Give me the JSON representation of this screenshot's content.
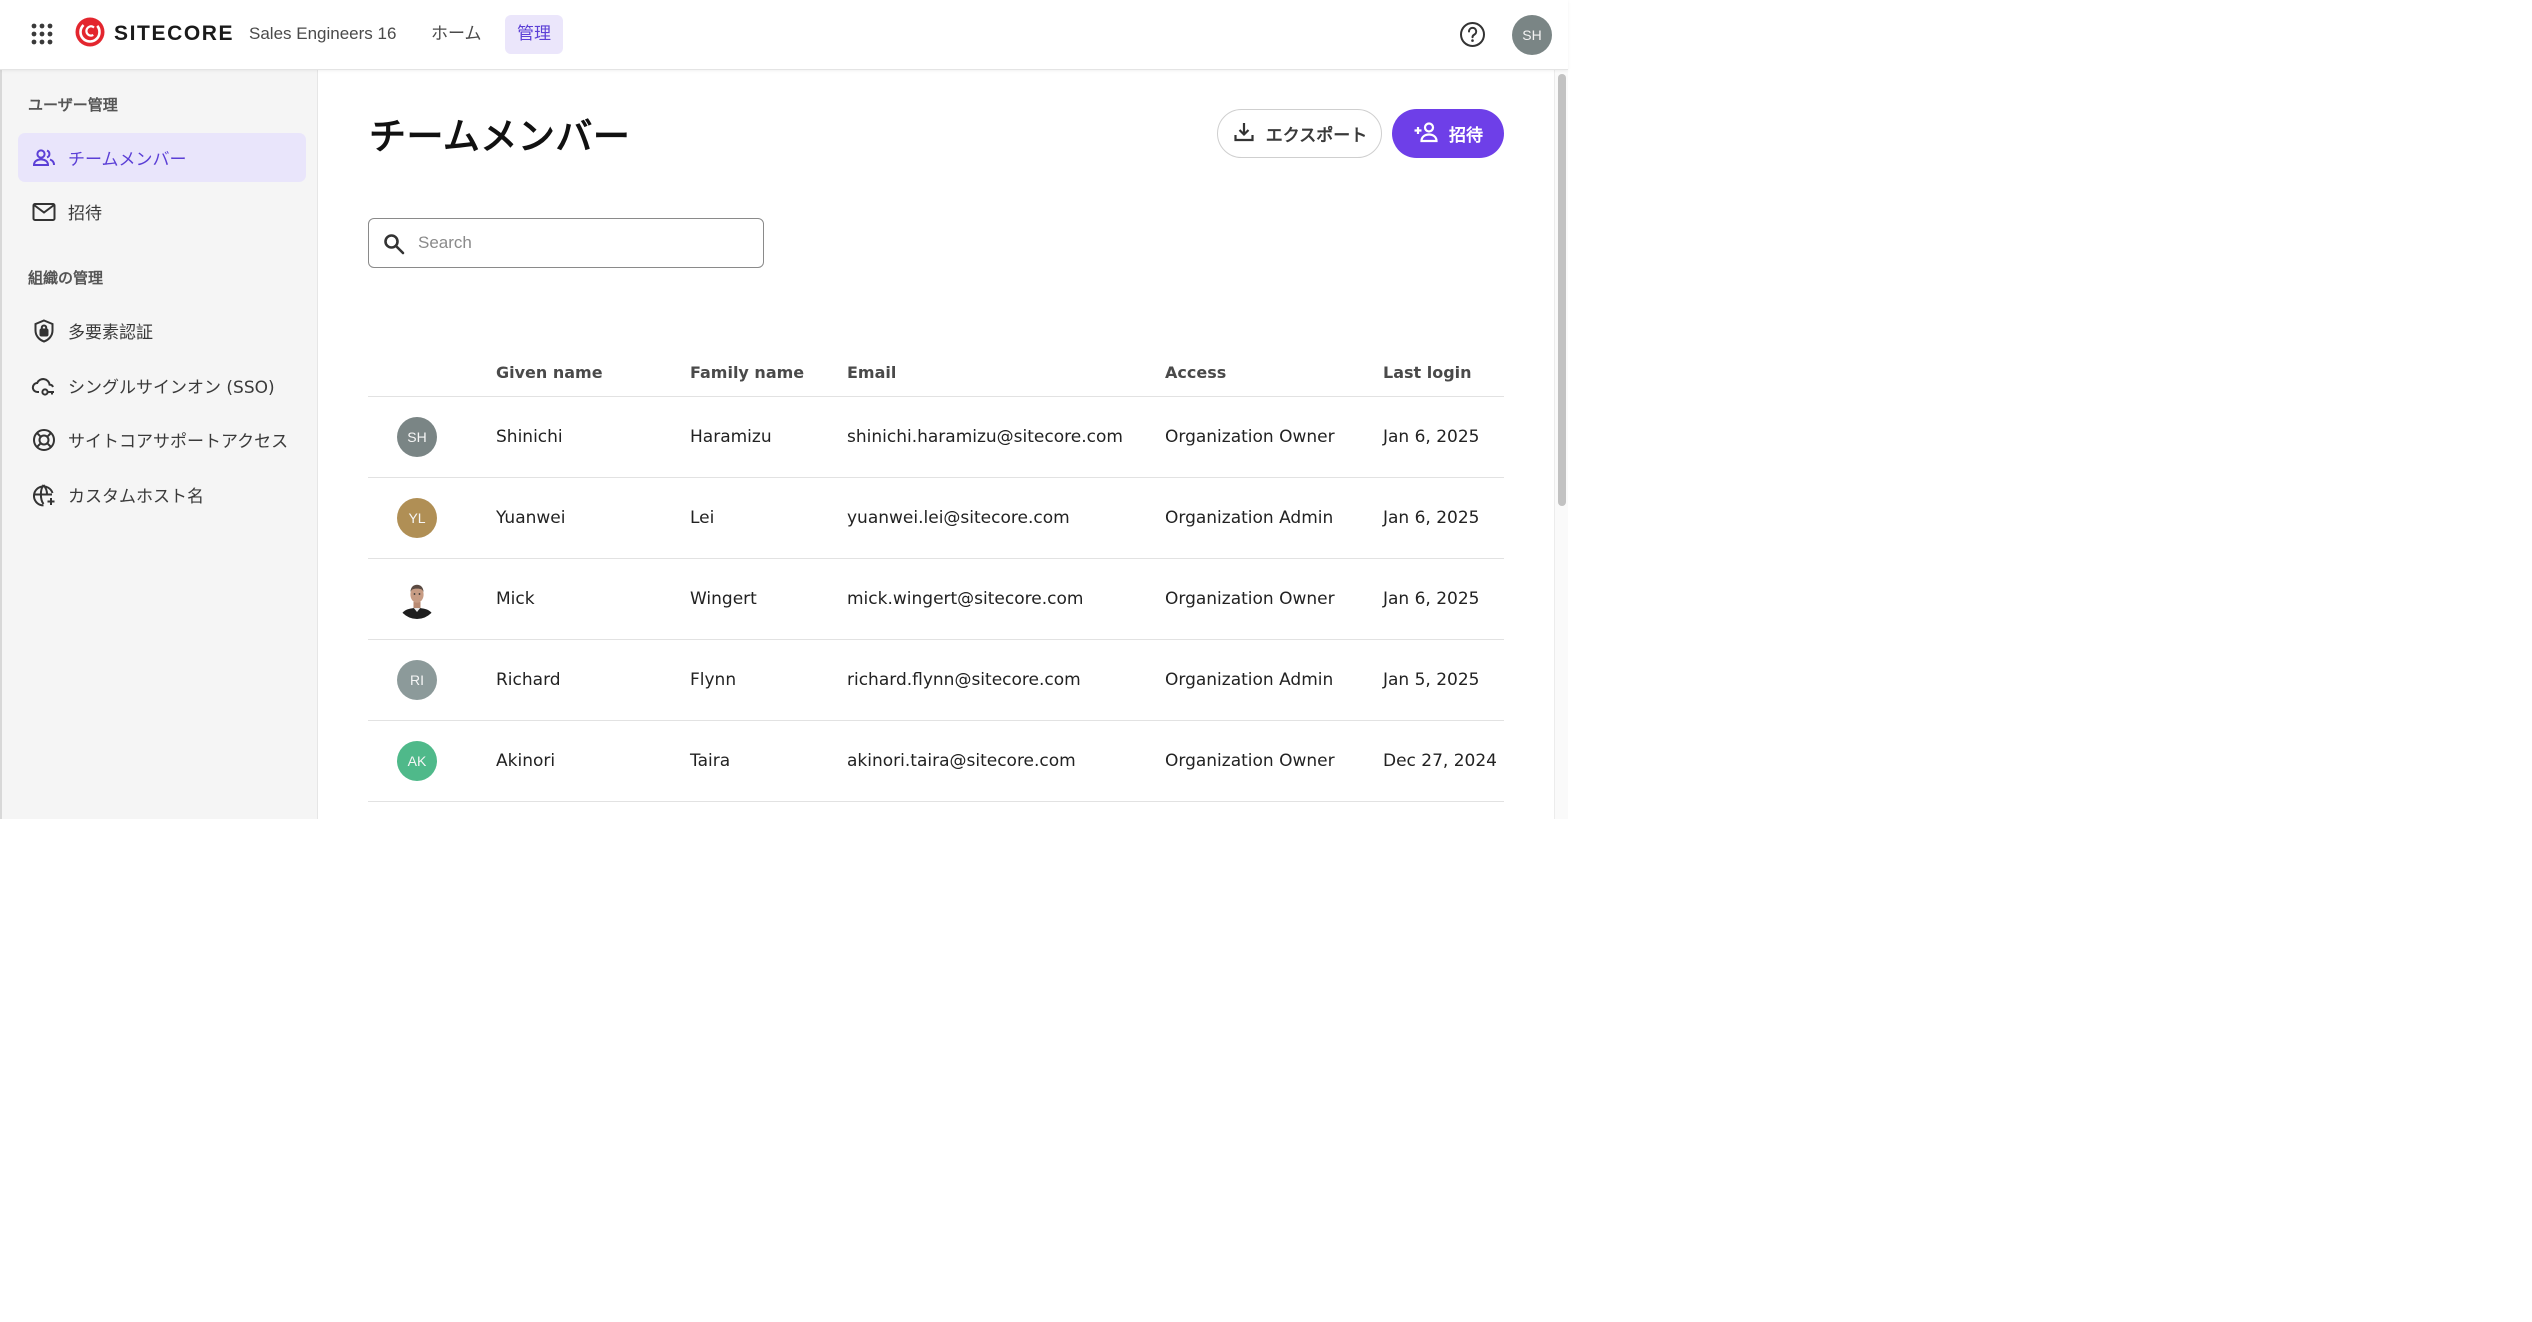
{
  "header": {
    "logo_text": "SITECORE",
    "org_name": "Sales Engineers 16",
    "nav": [
      {
        "label": "ホーム",
        "active": false
      },
      {
        "label": "管理",
        "active": true
      }
    ],
    "user_initials": "SH",
    "icons": {
      "apps": "apps-grid-icon",
      "help": "help-circle-icon",
      "logo": "sitecore-logo-icon"
    }
  },
  "sidebar": {
    "section_user": "ユーザー管理",
    "user_items": [
      {
        "label": "チームメンバー",
        "icon": "people-icon",
        "active": true
      },
      {
        "label": "招待",
        "icon": "mail-icon",
        "active": false
      }
    ],
    "section_org": "組織の管理",
    "org_items": [
      {
        "label": "多要素認証",
        "icon": "shield-lock-icon"
      },
      {
        "label": "シングルサインオン (SSO)",
        "icon": "cloud-key-icon"
      },
      {
        "label": "サイトコアサポートアクセス",
        "icon": "lifebuoy-icon"
      },
      {
        "label": "カスタムホスト名",
        "icon": "globe-plus-icon"
      }
    ]
  },
  "main": {
    "title": "チームメンバー",
    "export_label": "エクスポート",
    "invite_label": "招待",
    "search_placeholder": "Search"
  },
  "table": {
    "columns": [
      "Given name",
      "Family name",
      "Email",
      "Access",
      "Last login"
    ],
    "rows": [
      {
        "initials": "SH",
        "avatar_color": "#7a8585",
        "given": "Shinichi",
        "family": "Haramizu",
        "email": "shinichi.haramizu@sitecore.com",
        "access": "Organization Owner",
        "last_login": "Jan 6, 2025"
      },
      {
        "initials": "YL",
        "avatar_color": "#b08f55",
        "given": "Yuanwei",
        "family": "Lei",
        "email": "yuanwei.lei@sitecore.com",
        "access": "Organization Admin",
        "last_login": "Jan 6, 2025"
      },
      {
        "initials": "",
        "avatar_color": "#ffffff",
        "photo": true,
        "given": "Mick",
        "family": "Wingert",
        "email": "mick.wingert@sitecore.com",
        "access": "Organization Owner",
        "last_login": "Jan 6, 2025"
      },
      {
        "initials": "RI",
        "avatar_color": "#8c9a9a",
        "given": "Richard",
        "family": "Flynn",
        "email": "richard.flynn@sitecore.com",
        "access": "Organization Admin",
        "last_login": "Jan 5, 2025"
      },
      {
        "initials": "AK",
        "avatar_color": "#4fb98a",
        "given": "Akinori",
        "family": "Taira",
        "email": "akinori.taira@sitecore.com",
        "access": "Organization Owner",
        "last_login": "Dec 27, 2024"
      }
    ]
  },
  "colors": {
    "accent": "#6e3fe8",
    "accent_text": "#5b3fd6",
    "active_bg": "#e9e5fb",
    "logo_red": "#e3262e"
  }
}
